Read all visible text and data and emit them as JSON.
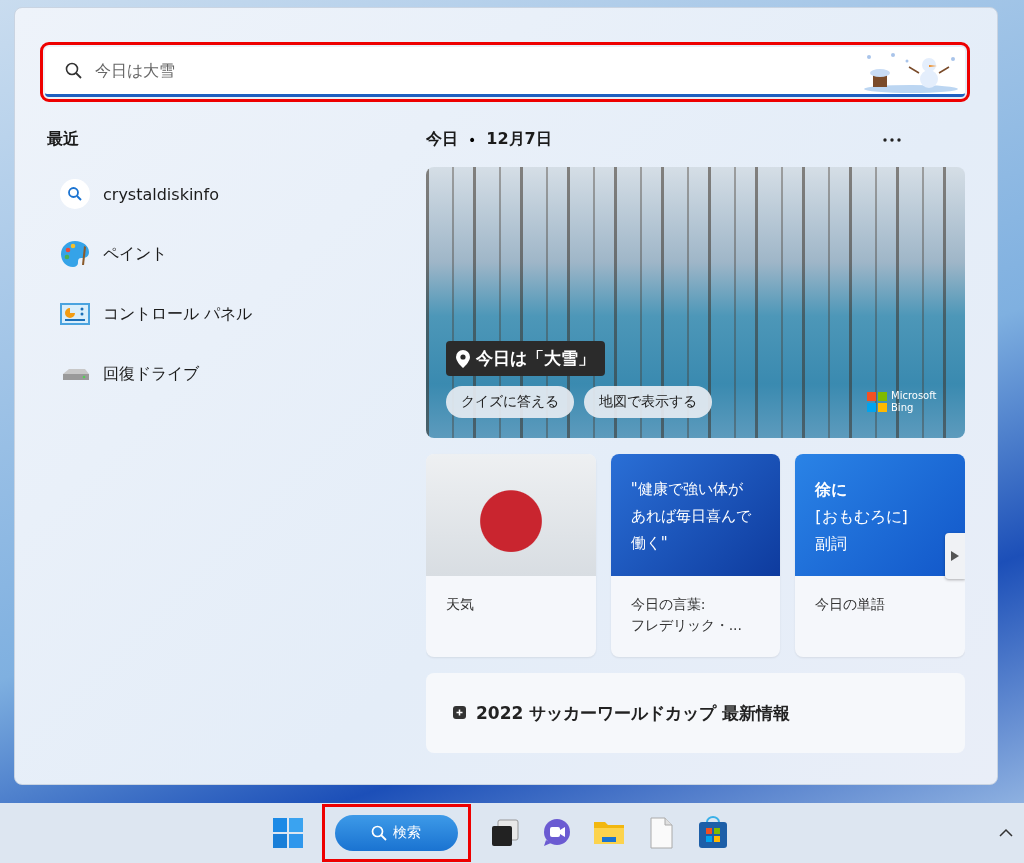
{
  "search": {
    "placeholder": "今日は大雪",
    "highlighted": true
  },
  "recent": {
    "heading": "最近",
    "items": [
      {
        "label": "crystaldiskinfo",
        "kind": "search"
      },
      {
        "label": "ペイント",
        "kind": "paint"
      },
      {
        "label": "コントロール パネル",
        "kind": "control"
      },
      {
        "label": "回復ドライブ",
        "kind": "drive"
      }
    ]
  },
  "today": {
    "heading": "今日",
    "separator": "•",
    "date": "12月7日",
    "hero": {
      "location": "今日は「大雪」",
      "actions": [
        "クイズに答える",
        "地図で表示する"
      ],
      "brand": "Microsoft Bing"
    },
    "cards": [
      {
        "kind": "photo",
        "caption": "天気"
      },
      {
        "kind": "quote",
        "text": "\"健康で強い体があれば毎日喜んで働く\"",
        "caption": "今日の言葉:\nフレデリック・..."
      },
      {
        "kind": "word",
        "word": "徐に",
        "reading": "[おもむろに]",
        "part": "副詞",
        "caption": "今日の単語"
      }
    ],
    "news": "2022 サッカーワールドカップ 最新情報"
  },
  "taskbar": {
    "search": {
      "label": "検索",
      "highlighted": true
    },
    "apps": [
      {
        "kind": "taskview"
      },
      {
        "kind": "chat"
      },
      {
        "kind": "explorer"
      },
      {
        "kind": "notepad"
      },
      {
        "kind": "store"
      }
    ]
  }
}
